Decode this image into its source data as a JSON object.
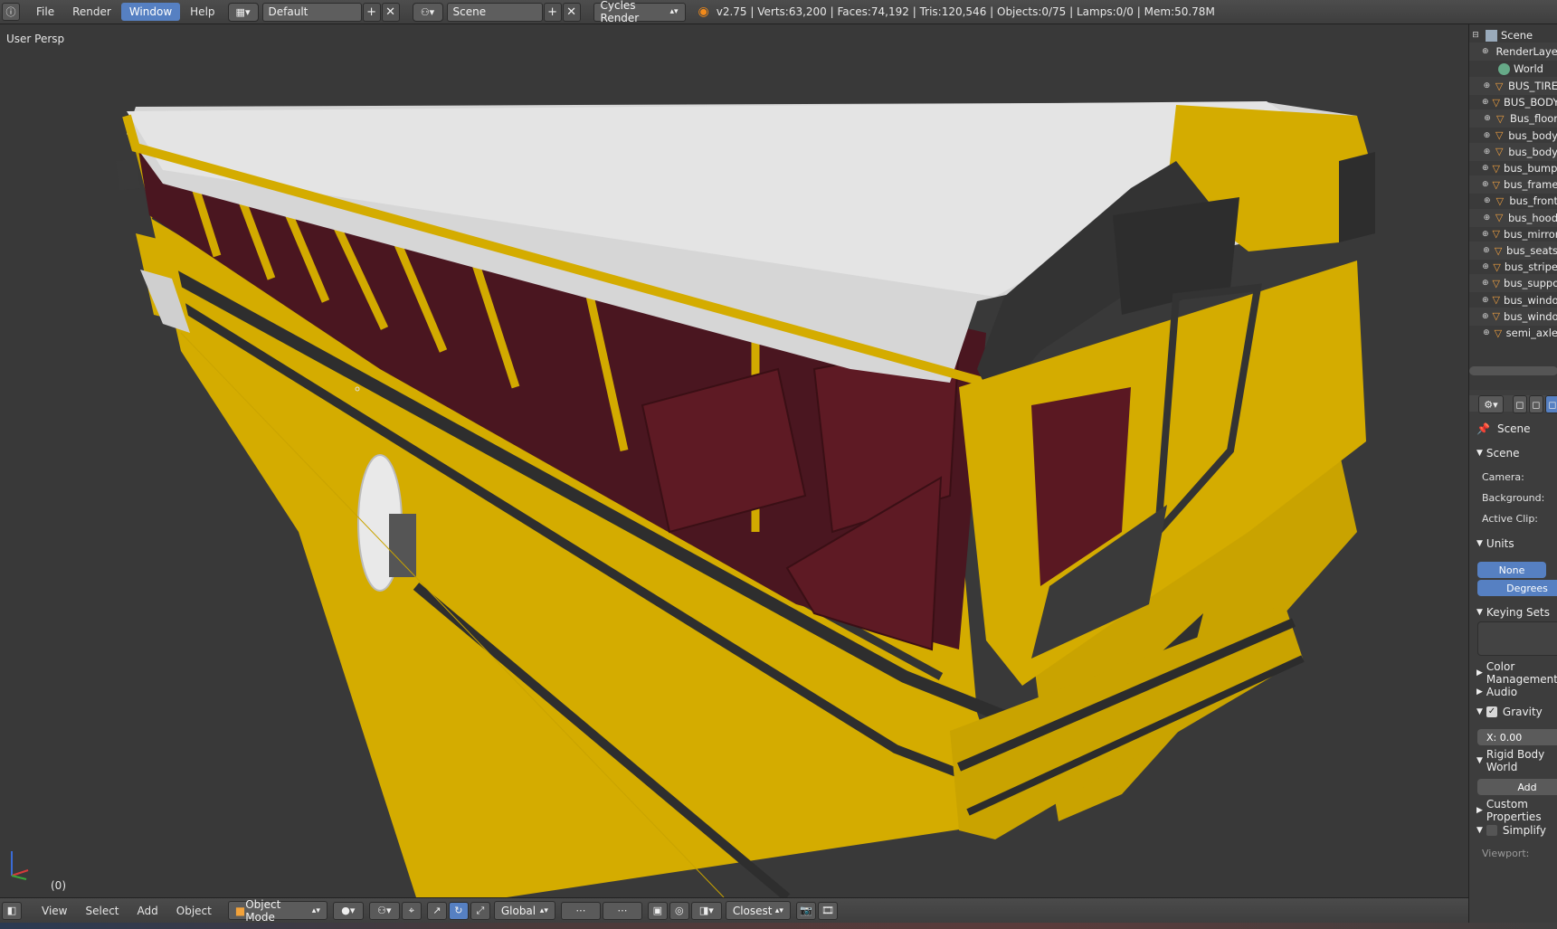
{
  "topbar": {
    "info_icon": "info-icon",
    "menus": [
      "File",
      "Render",
      "Window",
      "Help"
    ],
    "active_menu": "Window",
    "layout_icon": "screen-layout-icon",
    "layout": "Default",
    "scene_icon": "scene-icon",
    "scene": "Scene",
    "render_engine": "Cycles Render",
    "blender_logo": "blender-logo-icon",
    "stats": "v2.75 | Verts:63,200 | Faces:74,192 | Tris:120,546 | Objects:0/75 | Lamps:0/0 | Mem:50.78M"
  },
  "viewport": {
    "label": "User Persp",
    "frame": "(0)",
    "axis_icon": "xyz-axis-icon"
  },
  "bottombar": {
    "editor_icon": "3d-view-editor-icon",
    "menus": [
      "View",
      "Select",
      "Add",
      "Object"
    ],
    "mode": "Object Mode",
    "shading_icon": "viewport-shading-icon",
    "pivot_icon": "pivot-point-icon",
    "manipulator_icons": [
      "translate-icon",
      "rotate-icon",
      "scale-icon"
    ],
    "orientation": "Global",
    "snap": "Closest"
  },
  "outliner": {
    "items": [
      {
        "label": "Scene",
        "icon": "scene-icon"
      },
      {
        "label": "RenderLayers",
        "icon": "render-layers-icon"
      },
      {
        "label": "World",
        "icon": "world-icon"
      },
      {
        "label": "BUS_TIRE",
        "icon": "mesh-icon"
      },
      {
        "label": "BUS_BODY",
        "icon": "mesh-icon"
      },
      {
        "label": "Bus_floor",
        "icon": "mesh-icon"
      },
      {
        "label": "bus_body",
        "icon": "mesh-icon"
      },
      {
        "label": "bus_body",
        "icon": "mesh-icon"
      },
      {
        "label": "bus_bumper",
        "icon": "mesh-icon"
      },
      {
        "label": "bus_frame",
        "icon": "mesh-icon"
      },
      {
        "label": "bus_front",
        "icon": "mesh-icon"
      },
      {
        "label": "bus_hood",
        "icon": "mesh-icon"
      },
      {
        "label": "bus_mirror",
        "icon": "mesh-icon"
      },
      {
        "label": "bus_seats",
        "icon": "mesh-icon"
      },
      {
        "label": "bus_stripe",
        "icon": "mesh-icon"
      },
      {
        "label": "bus_support",
        "icon": "mesh-icon"
      },
      {
        "label": "bus_window",
        "icon": "mesh-icon"
      },
      {
        "label": "bus_window",
        "icon": "mesh-icon"
      },
      {
        "label": "semi_axle",
        "icon": "mesh-icon"
      }
    ]
  },
  "properties": {
    "breadcrumb": "Scene",
    "scene_panel": "Scene",
    "camera_label": "Camera:",
    "background_label": "Background:",
    "active_clip_label": "Active Clip:",
    "units_panel": "Units",
    "units_none": "None",
    "units_degrees": "Degrees",
    "keying_sets_panel": "Keying Sets",
    "color_management_panel": "Color Management",
    "audio_panel": "Audio",
    "gravity_panel": "Gravity",
    "gravity_x": "X:   0.00",
    "rigid_body_panel": "Rigid Body World",
    "add_button": "Add",
    "custom_props_panel": "Custom Properties",
    "simplify_panel": "Simplify",
    "viewport_label": "Viewport:"
  },
  "colors": {
    "accent": "#5680c2",
    "bus_yellow": "#d4ac00",
    "roof_white": "#e0e0e0",
    "seat_red": "#5a1a22",
    "trim_dark": "#2f2f2f"
  }
}
